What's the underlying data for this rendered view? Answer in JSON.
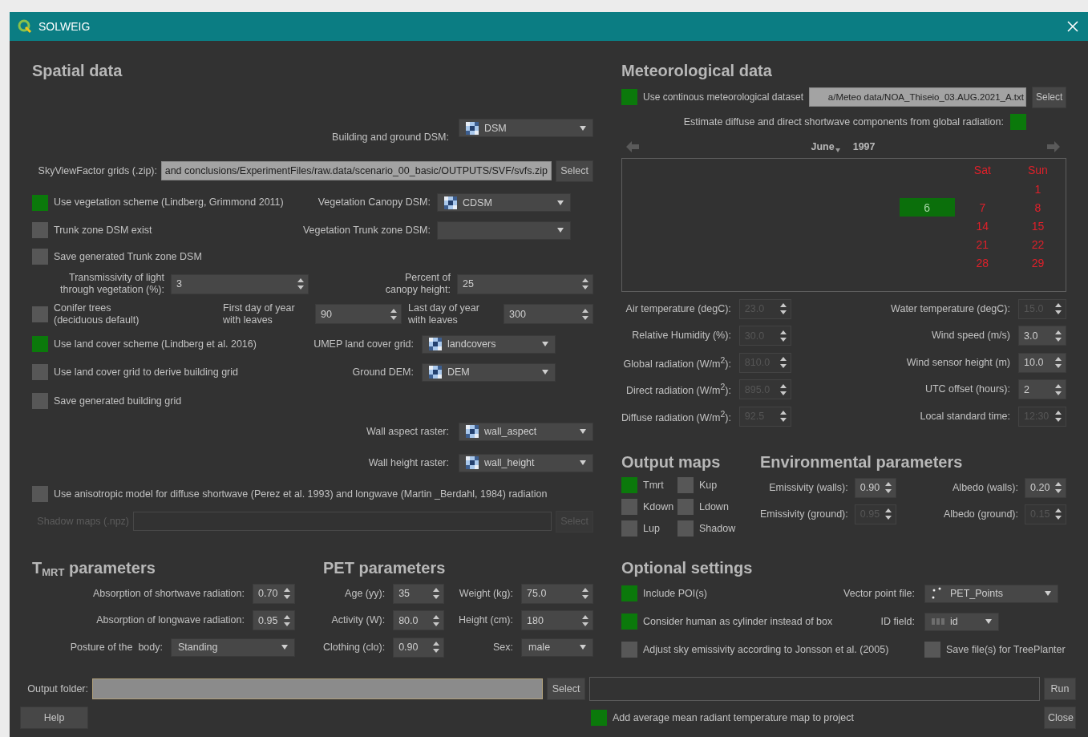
{
  "window": {
    "title": "SOLWEIG"
  },
  "spatial_data": {
    "heading": "Spatial data",
    "rows": [
      [
        {
          "kind": "label",
          "text": "Building and ground DSM:"
        },
        {
          "kind": "combo",
          "value": "DSM"
        }
      ],
      [
        {
          "kind": "label",
          "text": "SkyViewFactor grids (.zip):"
        },
        {
          "kind": "path",
          "value": "and conclusions/ExperimentFiles/raw.data/scenario_00_basic/OUTPUTS/SVF/svfs.zip",
          "disabled": false
        },
        {
          "kind": "button",
          "label": "Select",
          "disabled": false
        }
      ],
      [
        {
          "kind": "check",
          "label": "Use vegetation scheme (Lindberg, Grimmond 2011)",
          "checked": true
        },
        {
          "kind": "label",
          "text": "Vegetation Canopy DSM:"
        },
        {
          "kind": "combo",
          "value": "CDSM"
        }
      ],
      [
        {
          "kind": "check",
          "label": "Trunk zone DSM exist",
          "checked": false
        },
        {
          "kind": "label",
          "text": "Vegetation Trunk zone DSM:"
        },
        {
          "kind": "combo"
        }
      ],
      [
        {
          "kind": "check",
          "label": "Save generated Trunk zone DSM",
          "checked": false
        }
      ],
      [
        {
          "kind": "label",
          "text": "Transmissivity of light\nthrough vegetation (%):"
        },
        {
          "kind": "spin",
          "value": "3",
          "disabled": false
        },
        {
          "kind": "label",
          "text": "Percent of\ncanopy height:"
        },
        {
          "kind": "spin",
          "value": "25",
          "disabled": false
        }
      ],
      [
        {
          "kind": "check",
          "label": "Conifer trees\n(deciduous default)",
          "checked": false
        },
        {
          "kind": "label",
          "text": "First day of year\nwith leaves"
        },
        {
          "kind": "spin",
          "value": "90",
          "disabled": false
        },
        {
          "kind": "label",
          "text": "Last day of year\nwith leaves"
        },
        {
          "kind": "spin",
          "value": "300",
          "disabled": false
        }
      ],
      [
        {
          "kind": "check",
          "label": "Use land cover scheme (Lindberg et al. 2016)",
          "checked": true
        },
        {
          "kind": "label",
          "text": "UMEP land cover grid:"
        },
        {
          "kind": "combo",
          "value": "landcovers"
        }
      ],
      [
        {
          "kind": "check",
          "label": "Use land cover grid to derive building grid",
          "checked": false
        },
        {
          "kind": "label",
          "text": "Ground DEM:"
        },
        {
          "kind": "combo",
          "value": "DEM"
        }
      ],
      [
        {
          "kind": "check",
          "label": "Save generated building grid",
          "checked": false
        }
      ],
      [
        {
          "kind": "label",
          "text": "Wall aspect raster:"
        },
        {
          "kind": "combo",
          "value": "wall_aspect"
        }
      ],
      [
        {
          "kind": "label",
          "text": "Wall height raster:"
        },
        {
          "kind": "combo",
          "value": "wall_height"
        }
      ],
      [
        {
          "kind": "check",
          "label": "Use anisotropic model for diffuse shortwave (Perez et al. 1993) and longwave (Martin _Berdahl, 1984) radiation",
          "checked": false
        }
      ],
      [
        {
          "kind": "label",
          "text": "Shadow maps (.npz)",
          "disabled": true
        },
        {
          "kind": "path",
          "disabled": true
        },
        {
          "kind": "button",
          "label": "Select",
          "disabled": true
        }
      ]
    ]
  },
  "meteorological_data": {
    "heading": "Meteorological data",
    "dataset_check": {
      "label": "Use continous meteorological dataset",
      "checked": true
    },
    "dataset_path": "a/Meteo data/NOA_Thiseio_03.AUG.2021_A.txt",
    "select_button": "Select",
    "estimate_check": {
      "label": "Estimate diffuse and direct shortwave components from global radiation:",
      "checked": true
    },
    "calendar": {
      "month": "June",
      "year": "1997",
      "headers": {
        "sat": "Sat",
        "sun": "Sun"
      },
      "weeks": [
        {
          "sun": {
            "text": "1",
            "selected": false
          }
        },
        {
          "fri": {
            "text": "6",
            "selected": true
          },
          "sat": {
            "text": "7",
            "selected": false
          },
          "sun": {
            "text": "8",
            "selected": false
          }
        },
        {
          "sat": {
            "text": "14",
            "selected": false
          },
          "sun": {
            "text": "15",
            "selected": false
          }
        },
        {
          "sat": {
            "text": "21",
            "selected": false
          },
          "sun": {
            "text": "22",
            "selected": false
          }
        },
        {
          "sat": {
            "text": "28",
            "selected": false
          },
          "sun": {
            "text": "29",
            "selected": false
          }
        }
      ]
    },
    "fields": [
      {
        "label": "Air temperature (degC):",
        "value": "23.0",
        "disabled": true
      },
      {
        "label": "Water temperature (degC):",
        "value": "15.0",
        "disabled": true
      },
      {
        "label": "Relative Humidity (%):",
        "value": "30.0",
        "disabled": true
      },
      {
        "label": "Wind speed (m/s)",
        "value": "3.0",
        "disabled": false
      },
      {
        "label": "Global radiation (W/m$^{2}$):",
        "value": "810.0",
        "disabled": true
      },
      {
        "label": "Wind sensor height (m)",
        "value": "10.0",
        "disabled": false
      },
      {
        "label": "Direct radiation (W/m$^{2}$):",
        "value": "895.0",
        "disabled": true
      },
      {
        "label": "UTC offset (hours):",
        "value": "2",
        "disabled": false
      },
      {
        "label": "Diffuse radiation (W/m$^{2}$):",
        "value": "92.5",
        "disabled": true
      },
      {
        "label": "Local standard time:",
        "value": "12:30",
        "disabled": true
      }
    ]
  },
  "output_maps": {
    "heading": "Output maps",
    "checks": [
      {
        "label": "Tmrt",
        "checked": true
      },
      {
        "label": "Kup",
        "checked": false
      },
      {
        "label": "Kdown",
        "checked": false
      },
      {
        "label": "Ldown",
        "checked": false
      },
      {
        "label": "Lup",
        "checked": false
      },
      {
        "label": "Shadow",
        "checked": false
      }
    ]
  },
  "environmental_parameters": {
    "heading": "Environmental parameters",
    "fields": [
      {
        "label": "Emissivity (walls):",
        "value": "0.90",
        "disabled": false
      },
      {
        "label": "Albedo (walls):",
        "value": "0.20",
        "disabled": false
      },
      {
        "label": "Emissivity (ground):",
        "value": "0.95",
        "disabled": true
      },
      {
        "label": "Albedo (ground):",
        "value": "0.15",
        "disabled": true
      }
    ]
  },
  "tmrt_parameters": {
    "heading": "T$_{MRT}$ parameters",
    "rows": [
      {
        "label": "Absorption of shortwave radiation:",
        "kind": "spin",
        "value": "0.70"
      },
      {
        "label": "Absorption of longwave radiation:",
        "kind": "spin",
        "value": "0.95"
      },
      {
        "label": "Posture of the  body:",
        "kind": "combo",
        "value": "Standing"
      }
    ]
  },
  "pet_parameters": {
    "heading": "PET parameters",
    "fields": [
      {
        "label": "Age (yy):",
        "kind": "spin",
        "value": "35"
      },
      {
        "label": "Weight (kg):",
        "kind": "spin",
        "value": "75.0"
      },
      {
        "label": "Activity (W):",
        "kind": "spin",
        "value": "80.0"
      },
      {
        "label": "Height (cm):",
        "kind": "spin",
        "value": "180"
      },
      {
        "label": "Clothing (clo):",
        "kind": "spin",
        "value": "0.90"
      },
      {
        "label": "Sex:",
        "kind": "combo",
        "value": "male"
      }
    ]
  },
  "optional_settings": {
    "heading": "Optional settings",
    "rows": [
      {
        "check": {
          "label": "Include POI(s)",
          "checked": true
        },
        "label": "Vector point file:",
        "dropdown": "PET_Points"
      },
      {
        "check": {
          "label": "Consider human as cylinder instead of box",
          "checked": true
        },
        "label": "ID field:",
        "dropdown": "id"
      },
      {
        "check": {
          "label": "Adjust sky emissivity according to Jonsson et al. (2005)",
          "checked": false
        },
        "side_check": {
          "label": "Save file(s) for TreePlanter",
          "checked": false
        }
      }
    ]
  },
  "footer": {
    "output_label": "Output folder:",
    "select_button": "Select",
    "run_button": "Run",
    "help_button": "Help",
    "add_map_check": {
      "label": "Add average mean radiant temperature map to project",
      "checked": true
    },
    "close_button": "Close"
  }
}
